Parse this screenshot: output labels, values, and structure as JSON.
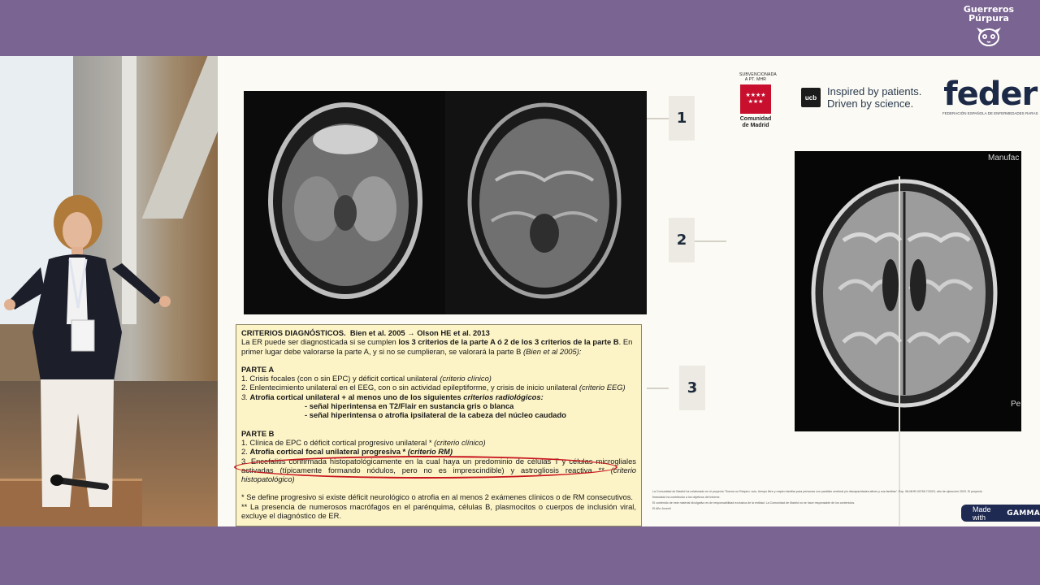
{
  "brand": {
    "line1": "Guerreros",
    "line2": "Púrpura",
    "icon": "lemur-face-icon"
  },
  "slide": {
    "steps": [
      "1",
      "2",
      "3"
    ],
    "mri_label_top": "Manufac",
    "mri_label_bottom": "Pe",
    "logos": {
      "cm_caption": "SUBVENCIONADA A PT. MHR",
      "cm_name_1": "Comunidad",
      "cm_name_2": "de Madrid",
      "ucb_mark": "ucb",
      "ucb_line1": "Inspired by patients.",
      "ucb_line2": "Driven by science.",
      "feder_big": "feder",
      "feder_small": "FEDERACIÓN ESPAÑOLA DE ENFERMEDADES RARAS"
    },
    "criteria": {
      "title": "CRITERIOS DIAGNÓSTICOS.",
      "refs": "Bien et al. 2005 → Olson HE et al. 2013",
      "intro_1": "La ER puede ser diagnosticada si se cumplen ",
      "intro_bold": "los 3 criterios de la parte A ó 2 de los 3 criterios de la parte B",
      "intro_2": ". En primer lugar debe valorarse la parte A, y si no se cumplieran, se valorará la parte B ",
      "intro_ref": "(Bien et al 2005):",
      "parte_a": "PARTE A",
      "a1": "1. Crisis focales (con o sin EPC) y déficit cortical unilateral ",
      "a1_em": "(criterio clínico)",
      "a2": "2. Enlentecimiento unilateral en el EEG, con o sin actividad epileptiforme, y crisis de inicio unilateral ",
      "a2_em": "(criterio EEG)",
      "a3_num": "3. ",
      "a3": "Atrofia cortical unilateral + al menos uno de los siguientes ",
      "a3_em": "criterios radiológicos:",
      "a3_sub1": "- señal hiperintensa en T2/Flair en sustancia gris o blanca",
      "a3_sub2": "- señal hiperintensa o atrofia ipsilateral de la cabeza del núcleo caudado",
      "parte_b": "PARTE B",
      "b1": "1. Clínica de EPC o déficit cortical progresivo unilateral * ",
      "b1_em": "(criterio clínico)",
      "b2_num": "2. ",
      "b2": "Atrofia cortical focal unilateral progresiva * ",
      "b2_em": "(criterio RM)",
      "b3": "3. Encefalitis confirmada histopatológicamente en la cual haya un predominio de células T y células microgliales activadas (típicamente formando nódulos, pero no es imprescindible) y astrogliosis reactiva ** ",
      "b3_em": "(criterio histopatológico)",
      "note1": "* Se define progresivo si existe déficit neurológico o atrofia en al menos 2 exámenes clínicos o de RM consecutivos.",
      "note2": "** La presencia de numerosos macrófagos en el parénquima, células B, plasmocitos o cuerpos de inclusión viral, excluye el diagnóstico de ER."
    },
    "fine_print_1": "La Comunidad de Madrid ha colaborado en el proyecto \"Somos un Respiro: ocio, tiempo libre y respiro familiar para personas con parálisis cerebral y/o discapacidades afines y sus familias\". Exp. 08-MHR-00765.7/2023, año de ejecución 2023. El proyecto financiado ha contribuido a los objetivos del informe.",
    "fine_print_2": "El contenido de este material divulgativo es de responsabilidad exclusiva de la entidad. La Comunidad de Madrid no se hace responsable de los contenidos.",
    "fine_print_3": "El Año Juvenil"
  },
  "footer": {
    "made_with": "Made with",
    "gamma": "GAMMA"
  }
}
